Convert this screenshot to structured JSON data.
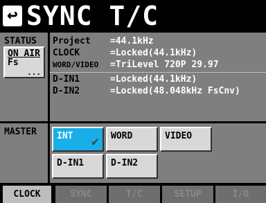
{
  "header": {
    "title": "SYNC T/C",
    "back_icon": "↩"
  },
  "status": {
    "label": "STATUS",
    "on_air_line1": "ON AIR",
    "on_air_line2": "Fs",
    "more": "..."
  },
  "info": {
    "rows": [
      {
        "key": "Project",
        "value": "=44.1kHz"
      },
      {
        "key": "CLOCK",
        "value": "=Locked(44.1kHz)"
      },
      {
        "key": "WORD/VIDEO",
        "value": "=TriLevel 720P 29.97"
      },
      {
        "key": "D-IN1",
        "value": "=Locked(44.1kHz)"
      },
      {
        "key": "D-IN2",
        "value": "=Locked(48.048kHz FsCnv)"
      }
    ]
  },
  "master": {
    "label": "MASTER",
    "buttons": [
      "INT",
      "WORD",
      "VIDEO",
      "D-IN1",
      "D-IN2"
    ],
    "selected": "INT"
  },
  "tabs": [
    "CLOCK",
    "SYNC",
    "T/C",
    "SETUP",
    "I/O"
  ],
  "active_tab": "CLOCK",
  "colors": {
    "panel": "#7f7f7f",
    "accent": "#1aaee8",
    "title_bg": "#000000"
  }
}
